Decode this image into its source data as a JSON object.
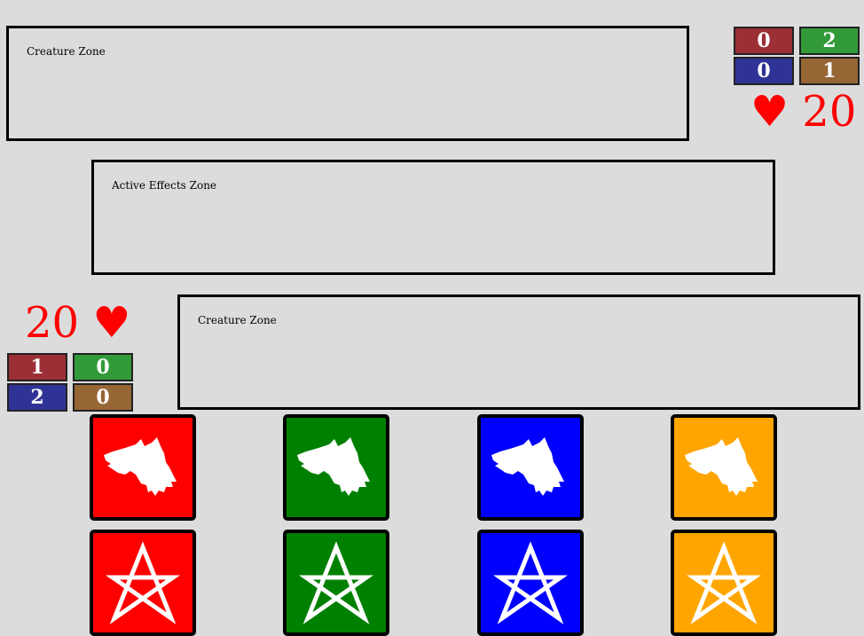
{
  "opponent": {
    "creature_zone_label": "Creature Zone",
    "mana": [
      {
        "color": "red",
        "value": "0",
        "hex": "#9b2f35"
      },
      {
        "color": "green",
        "value": "2",
        "hex": "#339a3a"
      },
      {
        "color": "blue",
        "value": "0",
        "hex": "#303396"
      },
      {
        "color": "brown",
        "value": "1",
        "hex": "#966635"
      }
    ],
    "life": "20",
    "life_icon": "♥"
  },
  "effects": {
    "label": "Active Effects Zone"
  },
  "player": {
    "creature_zone_label": "Creature Zone",
    "mana": [
      {
        "color": "red",
        "value": "1",
        "hex": "#9b2f35"
      },
      {
        "color": "green",
        "value": "0",
        "hex": "#339a3a"
      },
      {
        "color": "blue",
        "value": "2",
        "hex": "#303396"
      },
      {
        "color": "brown",
        "value": "0",
        "hex": "#966635"
      }
    ],
    "life": "20",
    "life_icon": "♥"
  },
  "hand": {
    "row1": [
      {
        "icon": "wolf-icon",
        "color": "#ff0000"
      },
      {
        "icon": "wolf-icon",
        "color": "#008000"
      },
      {
        "icon": "wolf-icon",
        "color": "#0000ff"
      },
      {
        "icon": "wolf-icon",
        "color": "#ffa500"
      }
    ],
    "row2": [
      {
        "icon": "unicursal-hexagram-icon",
        "color": "#ff0000"
      },
      {
        "icon": "unicursal-hexagram-icon",
        "color": "#008000"
      },
      {
        "icon": "unicursal-hexagram-icon",
        "color": "#0000ff"
      },
      {
        "icon": "unicursal-hexagram-icon",
        "color": "#ffa500"
      }
    ]
  }
}
